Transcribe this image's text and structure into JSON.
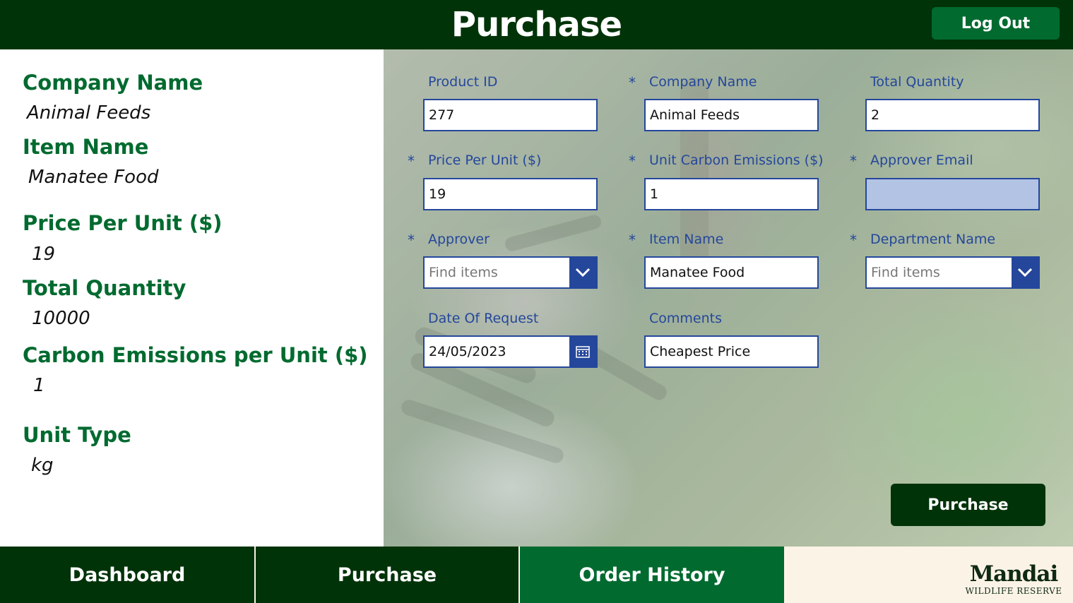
{
  "header": {
    "title": "Purchase",
    "logout_label": "Log Out"
  },
  "summary": {
    "company_label": "Company Name",
    "company_value": "Animal Feeds",
    "item_label": "Item Name",
    "item_value": "Manatee Food",
    "price_label": "Price Per Unit ($)",
    "price_value": "19",
    "quantity_label": "Total Quantity",
    "quantity_value": "10000",
    "carbon_label": "Carbon Emissions per Unit ($)",
    "carbon_value": "1",
    "unit_type_label": "Unit Type",
    "unit_type_value": "kg"
  },
  "form": {
    "product_id": {
      "label": "Product ID",
      "value": "277"
    },
    "company_name": {
      "label": "Company Name",
      "value": "Animal Feeds"
    },
    "total_quantity": {
      "label": "Total Quantity",
      "value": "2"
    },
    "price_per_unit": {
      "label": "Price Per Unit ($)",
      "value": "19"
    },
    "unit_carbon": {
      "label": "Unit Carbon Emissions ($)",
      "value": "1"
    },
    "approver_email": {
      "label": "Approver Email",
      "value": ""
    },
    "approver": {
      "label": "Approver",
      "placeholder": "Find items"
    },
    "item_name": {
      "label": "Item Name",
      "value": "Manatee Food"
    },
    "department_name": {
      "label": "Department Name",
      "placeholder": "Find items"
    },
    "date_of_request": {
      "label": "Date Of Request",
      "value": "24/05/2023"
    },
    "comments": {
      "label": "Comments",
      "value": "Cheapest Price"
    },
    "required_marker": "*",
    "submit_label": "Purchase"
  },
  "nav": {
    "items": [
      {
        "label": "Dashboard"
      },
      {
        "label": "Purchase"
      },
      {
        "label": "Order History"
      }
    ],
    "colors": {
      "dark": "#013309",
      "active": "#006a2f",
      "brand_bg": "#fbf3e6"
    }
  },
  "brand": {
    "name": "Mandai",
    "subtitle": "WILDLIFE RESERVE"
  },
  "icons": {
    "dropdown": "chevron-down-icon",
    "calendar": "calendar-icon"
  },
  "colors": {
    "header": "#013309",
    "accent_green": "#006a2f",
    "form_blue": "#24479b",
    "empty_field": "#b3c3e3"
  }
}
